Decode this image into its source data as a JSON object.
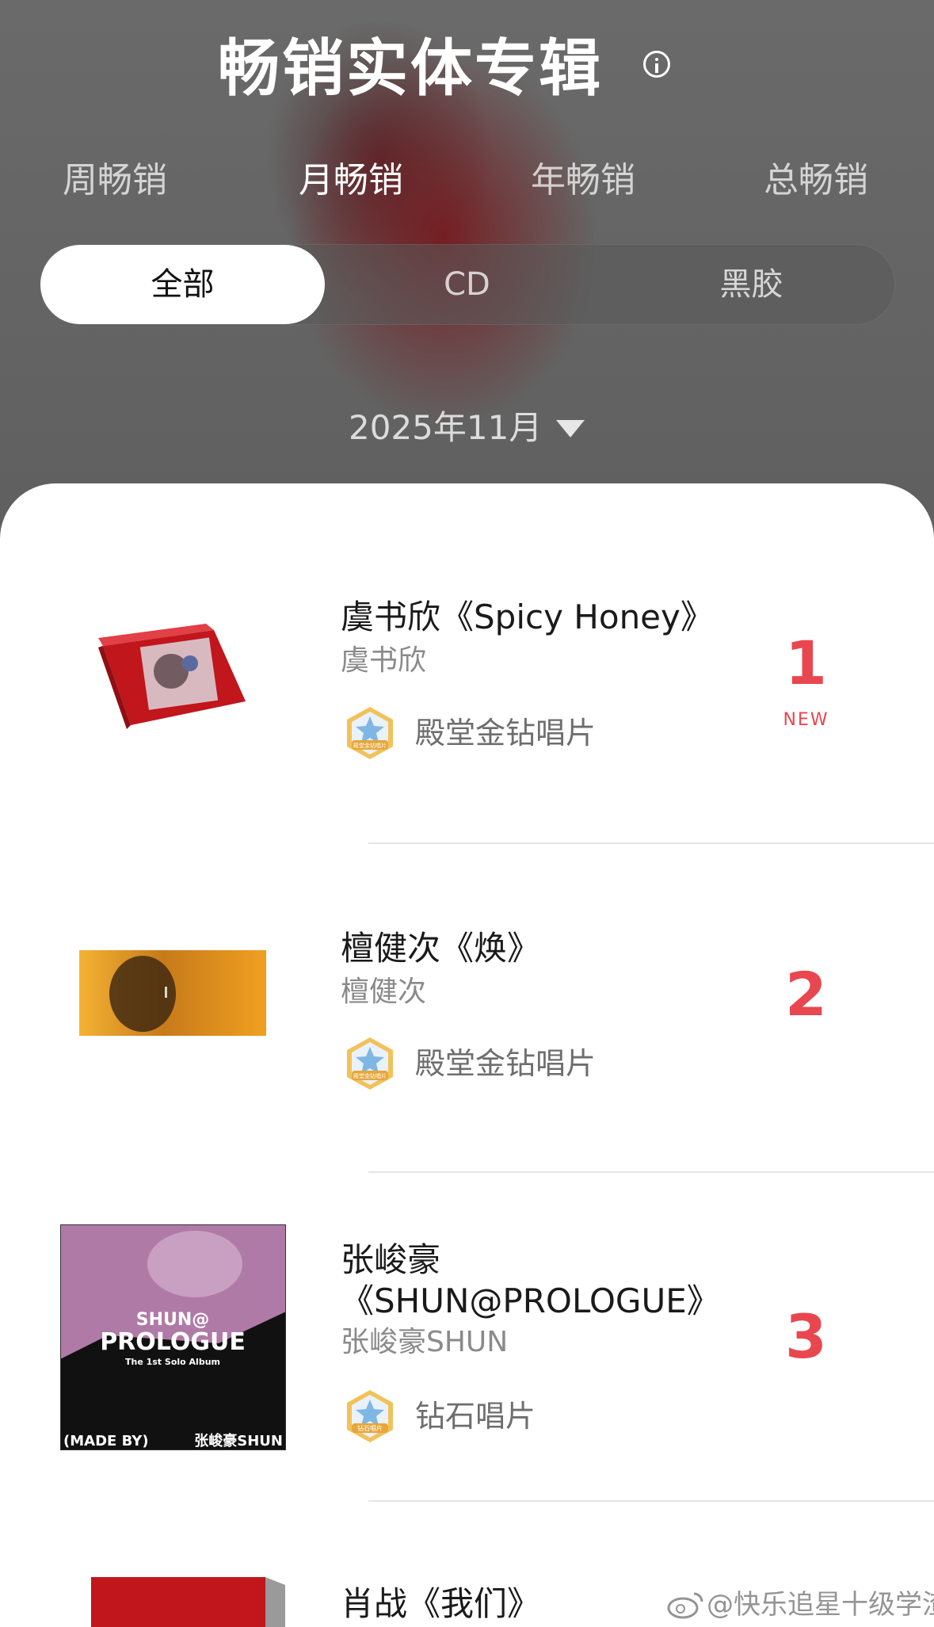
{
  "header": {
    "title": "畅销实体专辑",
    "period_tabs": [
      "周畅销",
      "月畅销",
      "年畅销",
      "总畅销"
    ],
    "active_period": "月畅销",
    "format_tabs": [
      "全部",
      "CD",
      "黑胶"
    ],
    "active_format": "全部",
    "date_selector": "2025年11月"
  },
  "albums": [
    {
      "rank": "1",
      "title": "虞书欣《Spicy Honey》",
      "artist": "虞书欣",
      "certification": "殿堂金钻唱片",
      "badge_text": "殿堂金钻唱片",
      "tag": "NEW"
    },
    {
      "rank": "2",
      "title": "檀健次《焕》",
      "artist": "檀健次",
      "certification": "殿堂金钻唱片",
      "badge_text": "殿堂金钻唱片"
    },
    {
      "rank": "3",
      "title_line1": "张峻豪",
      "title_line2": "《SHUN@PROLOGUE》",
      "artist": "张峻豪SHUN",
      "certification": "钻石唱片",
      "badge_text": "钻石唱片",
      "cover_text": {
        "line1": "SHUN@",
        "line2": "PROLOGUE",
        "line3": "The 1st Solo Album",
        "bottom_left": "(MADE BY)",
        "bottom_right": "张峻豪SHUN"
      }
    },
    {
      "title": "肖战《我们》"
    }
  ],
  "watermark": "@快乐追星十级学渣",
  "colors": {
    "rank_red": "#e9474f",
    "cover_red": "#c0161c",
    "cover_orange": "#f0a020"
  },
  "icons": {
    "info": "info-icon",
    "caret": "caret-down-icon",
    "badge": "award-badge-icon",
    "weibo": "weibo-icon"
  }
}
